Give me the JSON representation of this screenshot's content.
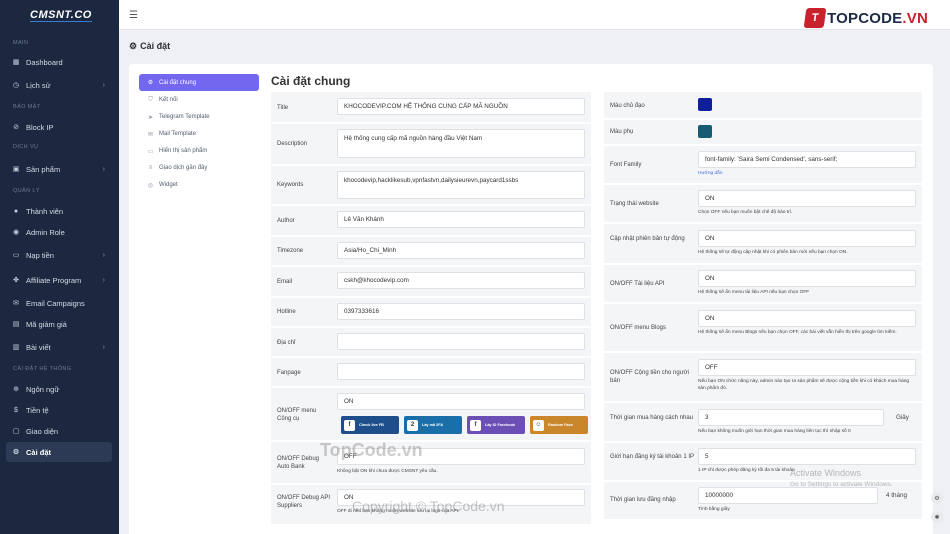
{
  "brand": {
    "logo": "CMSNT.CO",
    "topcode_badge": "T",
    "topcode_text": "TOPCODE",
    "topcode_tld": ".VN"
  },
  "sidebar": {
    "sections": [
      "MAIN",
      "BẢO MẬT",
      "DỊCH VỤ",
      "QUẢN LÝ",
      "CÀI ĐẶT HỆ THỐNG"
    ],
    "items": [
      {
        "label": "Dashboard",
        "icon": "dashboard-icon"
      },
      {
        "label": "Lịch sử",
        "icon": "history-icon",
        "has_children": true
      },
      {
        "label": "Block IP",
        "icon": "block-icon"
      },
      {
        "label": "Sản phẩm",
        "icon": "cart-icon",
        "has_children": true
      },
      {
        "label": "Thành viên",
        "icon": "user-icon"
      },
      {
        "label": "Admin Role",
        "icon": "admin-icon"
      },
      {
        "label": "Nạp tiền",
        "icon": "wallet-icon",
        "has_children": true
      },
      {
        "label": "Affiliate Program",
        "icon": "affiliate-icon",
        "has_children": true
      },
      {
        "label": "Email Campaigns",
        "icon": "mail-icon"
      },
      {
        "label": "Mã giảm giá",
        "icon": "coupon-icon"
      },
      {
        "label": "Bài viết",
        "icon": "post-icon",
        "has_children": true
      },
      {
        "label": "Ngôn ngữ",
        "icon": "language-icon"
      },
      {
        "label": "Tiền tệ",
        "icon": "currency-icon"
      },
      {
        "label": "Giao diện",
        "icon": "theme-icon"
      },
      {
        "label": "Cài đặt",
        "icon": "gear-icon",
        "active": true
      }
    ]
  },
  "page": {
    "title": "Cài đặt",
    "section_title": "Cài đặt chung"
  },
  "settings_nav": [
    {
      "label": "Cài đặt chung",
      "icon": "gear-icon",
      "active": true
    },
    {
      "label": "Kết nối",
      "icon": "plug-icon"
    },
    {
      "label": "Telegram Template",
      "icon": "telegram-icon"
    },
    {
      "label": "Mail Template",
      "icon": "mail-icon"
    },
    {
      "label": "Hiển thị sản phẩm",
      "icon": "monitor-icon"
    },
    {
      "label": "Giao dịch gần đây",
      "icon": "list-icon"
    },
    {
      "label": "Widget",
      "icon": "widget-icon"
    }
  ],
  "left_form": {
    "title": {
      "label": "Title",
      "value": "KHOCODEVIP.COM HỆ THỐNG CUNG CẤP MÃ NGUỒN"
    },
    "description": {
      "label": "Description",
      "value": "Hệ thống cung cấp mã  nguồn hàng đầu Việt Nam"
    },
    "keywords": {
      "label": "Keywords",
      "value": "khocodevip,hacklikesub,vpnfastvn,dailysieurevn,paycard1ssbs"
    },
    "author": {
      "label": "Author",
      "value": "Lê Văn Khánh"
    },
    "timezone": {
      "label": "Timezone",
      "value": "Asia/Ho_Chi_Minh"
    },
    "email": {
      "label": "Email",
      "value": "cskh@khocodevip.com"
    },
    "hotline": {
      "label": "Hotline",
      "value": "0397333616"
    },
    "address": {
      "label": "Địa chỉ",
      "value": ""
    },
    "fanpage": {
      "label": "Fanpage",
      "value": ""
    },
    "tools": {
      "label": "ON/OFF menu Công cụ",
      "value": "ON",
      "cards": [
        {
          "title": "Check live FB",
          "color": "#1e4f8a",
          "icon": "f"
        },
        {
          "title": "Lấy mã 2FA",
          "color": "#1b6fa8",
          "icon": "2"
        },
        {
          "title": "Lấy ID Facebook",
          "color": "#6b4fb5",
          "icon": "f"
        },
        {
          "title": "Random Face",
          "color": "#c9862a",
          "icon": "☺"
        }
      ]
    },
    "debug_auto_bank": {
      "label": "ON/OFF Debug Auto Bank",
      "value": "OFF",
      "help": "Không bật ON khi chưa được CMSNT yêu cầu."
    },
    "debug_api": {
      "label": "ON/OFF Debug API Suppliers",
      "value": "ON",
      "help": "OFF đi nếu bạn không muốn website lưu lại logs của API."
    }
  },
  "right_form": {
    "primary_color": {
      "label": "Màu chủ đạo",
      "color": "#0f1f9c"
    },
    "secondary_color": {
      "label": "Màu phụ",
      "color": "#175c72"
    },
    "font_family": {
      "label": "Font Family",
      "value": "font-family: 'Saira Semi Condensed', sans-serif;",
      "help": "Hướng dẫn"
    },
    "site_status": {
      "label": "Trạng thái website",
      "value": "ON",
      "help": "Chọn OFF nếu bạn muốn bật chế độ bảo trì."
    },
    "auto_update": {
      "label": "Cập nhật phiên bản tự động",
      "value": "ON",
      "help": "Hệ thống sẽ tự động cập nhật khi có phiên bản mới nếu bạn chọn ON."
    },
    "api_docs": {
      "label": "ON/OFF Tài liệu API",
      "value": "ON",
      "help": "Hệ thống sẽ ẩn menu tài liệu API nếu bạn chọn OFF"
    },
    "blogs_menu": {
      "label": "ON/OFF menu Blogs",
      "value": "ON",
      "help": "Hệ thống sẽ ẩn menu Blogs nếu bạn chọn OFF, các bài viết vẫn hiển thị trên google tìm kiếm."
    },
    "seller_bonus": {
      "label": "ON/OFF Cộng tiền cho người bán",
      "value": "OFF",
      "help": "Nếu bạn ON chức năng này, admin nào tạo ra sản phẩm sẽ được cộng tiền khi có khách mua hàng sản phẩm đó."
    },
    "cancel_time": {
      "label": "Thời gian mua hàng cách nhau",
      "value": "3",
      "suffix": "Giây",
      "help": "Nếu bạn không muốn giới hạn thời gian mua hàng liên tục thì nhập số 0"
    },
    "register_limit": {
      "label": "Giới hạn đăng ký tài khoản 1 IP",
      "value": "5",
      "help": "1 IP chỉ được phép đăng ký tối đa 5 tài khoản"
    },
    "login_time": {
      "label": "Thời gian lưu đăng nhập",
      "value": "10000000",
      "suffix": "4 tháng",
      "help": "Tính bằng giây"
    }
  },
  "overlay": {
    "wm1": "TopCode.vn",
    "wm2": "Copyright © TopCode.vn",
    "activate_title": "Activate Windows",
    "activate_sub": "Go to Settings to activate Windows."
  }
}
